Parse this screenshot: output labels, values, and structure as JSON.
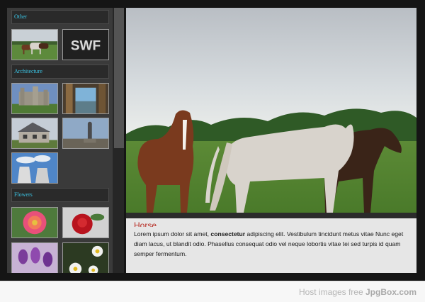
{
  "gallery": {
    "categories": [
      {
        "label": "Other"
      },
      {
        "label": "Architecture"
      },
      {
        "label": "Flowers"
      }
    ],
    "swf_thumb_text": "SWF",
    "thumbnails": [
      {
        "subject": "horses-field-thumbnail"
      },
      {
        "subject": "swf-thumbnail"
      },
      {
        "subject": "castle-thumbnail"
      },
      {
        "subject": "doorway-thumbnail"
      },
      {
        "subject": "house-thumbnail"
      },
      {
        "subject": "statue-thumbnail"
      },
      {
        "subject": "cooling-towers-thumbnail"
      },
      {
        "subject": "pink-flower-thumbnail"
      },
      {
        "subject": "red-rose-thumbnail"
      },
      {
        "subject": "purple-tulips-thumbnail"
      },
      {
        "subject": "white-daisies-thumbnail"
      }
    ]
  },
  "viewer": {
    "image_subject": "horses-in-meadow",
    "caption_title": "Horse",
    "caption_pre": "Lorem ipsum dolor sit amet, ",
    "caption_bold": "consectetur",
    "caption_post": " adipiscing elit. Vestibulum tincidunt metus vitae Nunc eget diam lacus, ut blandit odio. Phasellus consequat odio vel neque lobortis vitae tei sed turpis id quam semper fermentum."
  },
  "footer": {
    "text": "Host images free",
    "brand": "JpgBox.com"
  },
  "colors": {
    "frame": "#151515",
    "sidebar": "#3a3a3a",
    "category_text": "#3bc4e4",
    "caption_title": "#b8322a"
  }
}
